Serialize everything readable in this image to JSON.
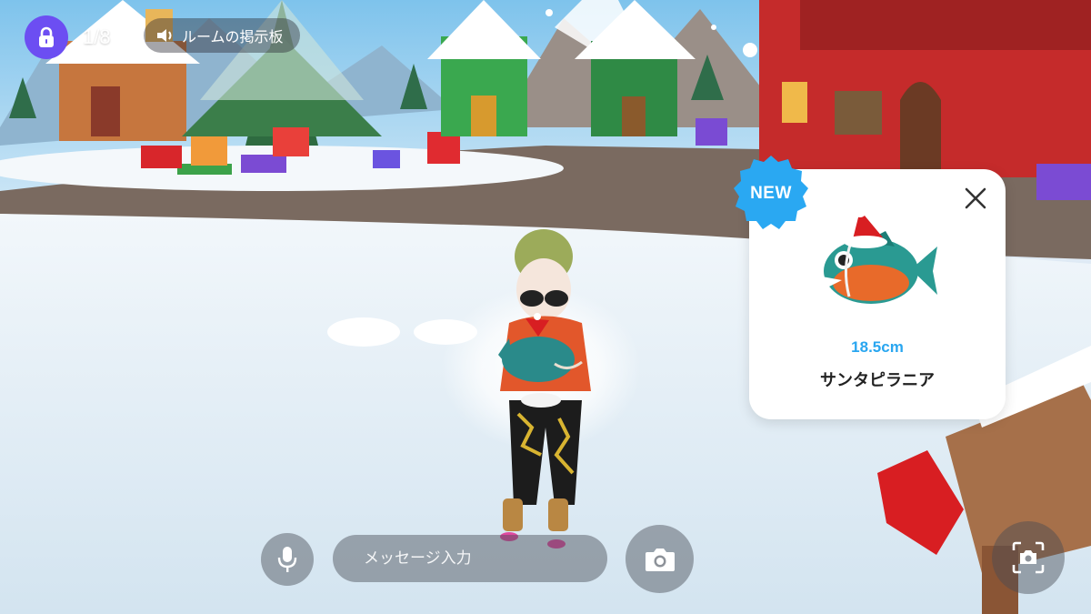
{
  "hud": {
    "room_count": "1/8",
    "board_label": "ルームの掲示板"
  },
  "item_card": {
    "badge": "NEW",
    "size": "18.5cm",
    "name": "サンタピラニア"
  },
  "chat": {
    "placeholder": "メッセージ入力"
  },
  "icons": {
    "lock": "lock-icon",
    "speaker": "speaker-icon",
    "close": "close-icon",
    "mic": "microphone-icon",
    "camera": "camera-icon",
    "screenshot": "screenshot-icon"
  },
  "colors": {
    "lock_button": "#6c4ef2",
    "new_badge": "#2aa8f2",
    "size_text": "#29a6f0"
  }
}
